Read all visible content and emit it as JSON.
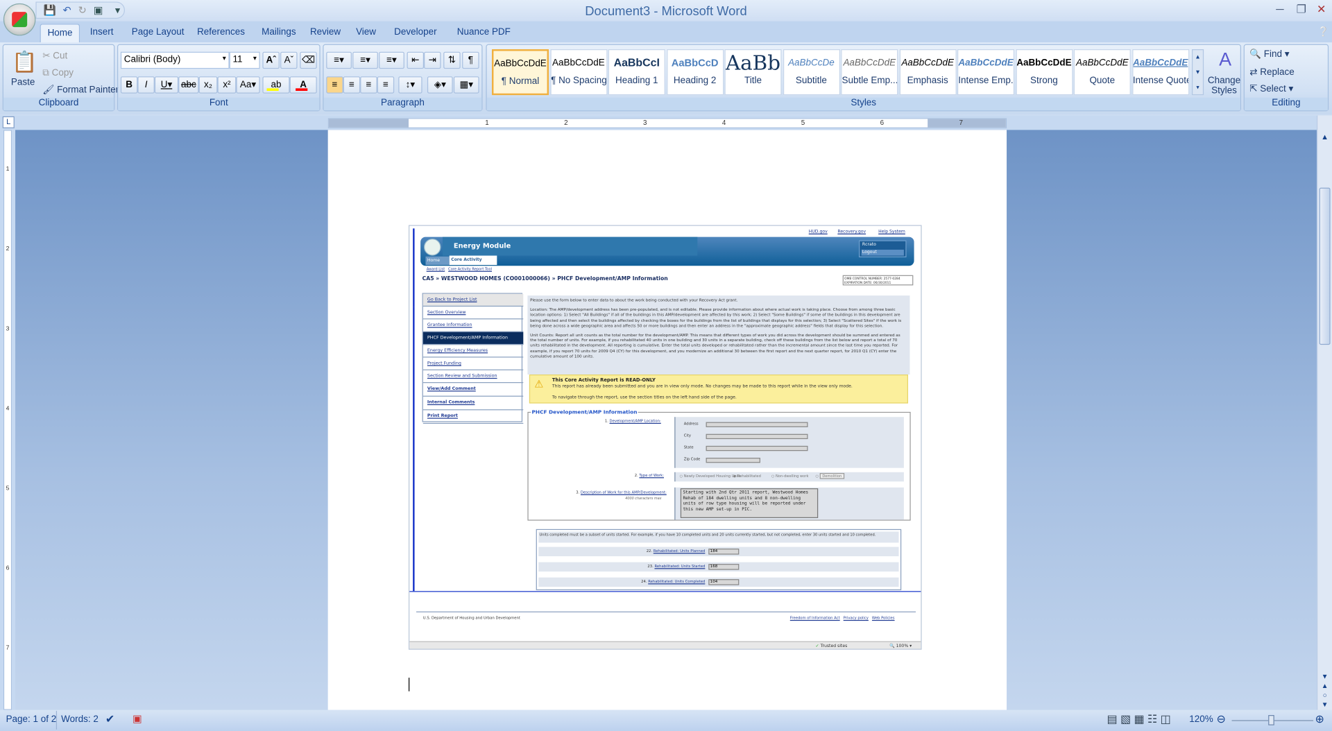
{
  "window": {
    "title": "Document3 - Microsoft Word"
  },
  "qat": {
    "icons": [
      "save-icon",
      "undo-icon",
      "redo-icon",
      "diagram-icon",
      "customize-icon"
    ]
  },
  "tabs": [
    "Home",
    "Insert",
    "Page Layout",
    "References",
    "Mailings",
    "Review",
    "View",
    "Developer",
    "Nuance PDF"
  ],
  "ribbon": {
    "clipboard": {
      "label": "Clipboard",
      "paste": "Paste",
      "cut": "Cut",
      "copy": "Copy",
      "format_painter": "Format Painter"
    },
    "font": {
      "label": "Font",
      "font_name": "Calibri (Body)",
      "font_size": "11",
      "highlight_color": "#ffff00",
      "font_color": "#ff0000"
    },
    "paragraph": {
      "label": "Paragraph"
    },
    "styles": {
      "label": "Styles",
      "items": [
        {
          "preview": "AaBbCcDdE",
          "name": "¶ Normal"
        },
        {
          "preview": "AaBbCcDdE",
          "name": "¶ No Spacing"
        },
        {
          "preview": "AaBbCcI",
          "name": "Heading 1"
        },
        {
          "preview": "AaBbCcD",
          "name": "Heading 2"
        },
        {
          "preview": "AaBb",
          "name": "Title"
        },
        {
          "preview": "AaBbCcDe",
          "name": "Subtitle"
        },
        {
          "preview": "AaBbCcDdE",
          "name": "Subtle Emp..."
        },
        {
          "preview": "AaBbCcDdE",
          "name": "Emphasis"
        },
        {
          "preview": "AaBbCcDdE",
          "name": "Intense Emp..."
        },
        {
          "preview": "AaBbCcDdE",
          "name": "Strong"
        },
        {
          "preview": "AaBbCcDdE",
          "name": "Quote"
        },
        {
          "preview": "AaBbCcDdE",
          "name": "Intense Quote"
        }
      ],
      "change_styles": "Change Styles"
    },
    "editing": {
      "label": "Editing",
      "find": "Find",
      "replace": "Replace",
      "select": "Select"
    }
  },
  "ruler": {
    "h_numbers": [
      "1",
      "2",
      "3",
      "4",
      "5",
      "6",
      "7"
    ],
    "v_numbers": [
      "1",
      "2",
      "3",
      "4",
      "5",
      "6",
      "7"
    ]
  },
  "embedded": {
    "top_links": [
      "HUD.gov",
      "Recovery.gov",
      "Help System"
    ],
    "module_title": "Energy Module",
    "user": "Rcrato",
    "logout": "Logout",
    "nav_tabs": [
      "Home",
      "Core Activity"
    ],
    "breadcrumb_links": [
      "Award List",
      "Core Activity Report Tool"
    ],
    "page_title": "CA5 » WESTWOOD HOMES (CO001000066) » PHCF Development/AMP Information",
    "omb": [
      "OMB CONTROL NUMBER: 2577-0284",
      "EXPIRATION DATE: 06/30/2011"
    ],
    "left_nav": [
      "Go Back to Project List",
      "Section Overview",
      "Grantee Information",
      "PHCF Development/AMP Information",
      "Energy Efficiency Measures",
      "Project Funding",
      "Section Review and Submission",
      "View/Add Comment",
      "Internal Comments",
      "Print Report"
    ],
    "instructions": [
      "Please use the form below to enter data to about the work being conducted with your Recovery Act grant.",
      "Location: The AMP/development address has been pre-populated, and is not editable. Please provide information about where actual work is taking place. Choose from among three basic location options: 1) Select \"All Buildings\" if all of the buildings in this AMP/development are affected by this work; 2) Select \"Some Buildings\" if some of the buildings in this development are being affected and then select the buildings affected by checking the boxes for the buildings from the list of buildings that displays for this selection; 3) Select \"Scattered Sites\" if the work is being done across a wide geographic area and affects 50 or more buildings and then enter an address in the \"approximate geographic address\" fields that display for this selection.",
      "Unit Counts: Report all unit counts as the total number for the development/AMP. This means that different types of work you did across the development should be summed and entered as the total number of units. For example, if you rehabilitated 40 units in one building and 30 units in a separate building, check off these buildings from the list below and report a total of 70 units rehabilitated in the development. All reporting is cumulative. Enter the total units developed or rehabilitated rather than the incremental amount since the last time you reported. For example, if you report 70 units for 2009 Q4 (CY) for this development, and you modernize an additional 30 between the first report and the next quarter report, for 2010 Q1 (CY) enter the cumulative amount of 100 units."
    ],
    "warning": {
      "title": "This Core Activity Report is READ-ONLY",
      "line1": "This report has already been submitted and you are in view only mode. No changes may be made to this report while in the view only mode.",
      "line2": "To navigate through the report, use the section titles on the left hand side of the page."
    },
    "section_title": "PHCF Development/AMP Information",
    "q1": {
      "num": "1.",
      "label": "Development/AMP Location:",
      "fields": [
        "Address",
        "City",
        "State",
        "Zip Code"
      ]
    },
    "q2": {
      "num": "2.",
      "label": "Type of Work:",
      "options": [
        "Newly Developed Housing Units",
        "Rehabilitated",
        "Non-dwelling work",
        "Demolition"
      ],
      "selected": "Rehabilitated"
    },
    "q3": {
      "num": "3.",
      "label": "Description of Work for this AMP/Development:",
      "hint": "4000 characters max",
      "value": "Starting with 2nd Qtr 2011 report, Westwood Homes Rehab of 184 dwelling units and 8 non-dwelling units of row type housing will be reported under this new AMP set-up in PIC."
    },
    "units_note": "Units completed must be a subset of units started. For example, if you have 10 completed units and 20 units currently started, but not completed, enter 30 units started and 10 completed.",
    "units": [
      {
        "num": "22.",
        "label": "Rehabilitated: Units Planned",
        "value": "184"
      },
      {
        "num": "23.",
        "label": "Rehabilitated: Units Started",
        "value": "168"
      },
      {
        "num": "24.",
        "label": "Rehabilitated: Units Completed",
        "value": "104"
      }
    ],
    "footer": {
      "left": "U.S. Department of Housing and Urban Development",
      "links": [
        "Freedom of Information Act",
        "Privacy policy",
        "Web Policies"
      ]
    },
    "ie_status": {
      "zone": "Trusted sites",
      "zoom": "100%"
    }
  },
  "status": {
    "page": "Page: 1 of 2",
    "words": "Words: 2",
    "zoom": "120%",
    "zoom_level": 120
  }
}
